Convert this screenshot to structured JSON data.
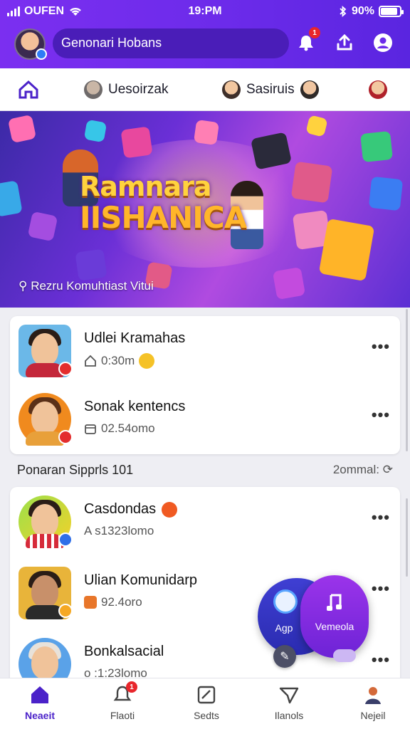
{
  "status_bar": {
    "carrier": "OUFEN",
    "time": "19:PM",
    "battery": "90%",
    "battery_level": 0.9
  },
  "header": {
    "search_text": "Genonari Hobans",
    "notification_count": "1"
  },
  "tabs": [
    {
      "label": ""
    },
    {
      "label": "Uesoirzak"
    },
    {
      "label": "Sasiruis"
    },
    {
      "label": ""
    }
  ],
  "banner": {
    "title_line1": "Ramnara",
    "title_line2": "IISHANICA",
    "caption": "Rezru Komuhtiast Vitui"
  },
  "card1": {
    "rows": [
      {
        "name": "Udlei Kramahas",
        "meta": "0:30m"
      },
      {
        "name": "Sonak kentencs",
        "meta": "02.54omo"
      }
    ]
  },
  "section": {
    "title": "Ponaran Sipprls 101",
    "count": "2ommal:"
  },
  "card2": {
    "rows": [
      {
        "name": "Casdondas",
        "meta": "A s1323lomo"
      },
      {
        "name": "Ulian Komunidarp",
        "meta": "92.4oro"
      },
      {
        "name": "Bonkalsacial",
        "meta": "o :1:23lomo"
      }
    ]
  },
  "fab": {
    "app_label": "Agp",
    "music_label": "Vemeola"
  },
  "bottom_nav": [
    {
      "label": "Neaeit"
    },
    {
      "label": "Flaoti"
    },
    {
      "label": "Sedts"
    },
    {
      "label": "Ilanols"
    },
    {
      "label": "Nejeil"
    }
  ],
  "colors": {
    "primary": "#6c2bea",
    "accent_red": "#e8262b",
    "banner_gold": "#ffd23e"
  }
}
